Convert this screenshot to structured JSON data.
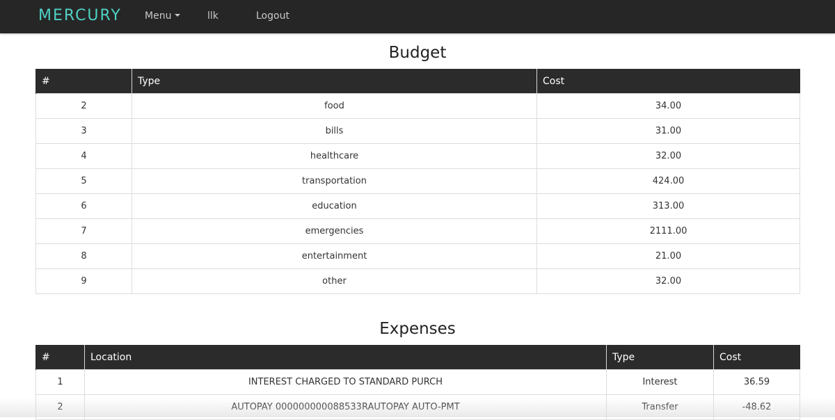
{
  "app": {
    "brand": "MERCURY",
    "nav": {
      "menu_label": "Menu",
      "user_label": "llk",
      "logout_label": "Logout"
    }
  },
  "budget": {
    "title": "Budget",
    "columns": [
      "#",
      "Type",
      "Cost"
    ],
    "rows": [
      {
        "id": "2",
        "type": "food",
        "cost": "34.00"
      },
      {
        "id": "3",
        "type": "bills",
        "cost": "31.00"
      },
      {
        "id": "4",
        "type": "healthcare",
        "cost": "32.00"
      },
      {
        "id": "5",
        "type": "transportation",
        "cost": "424.00"
      },
      {
        "id": "6",
        "type": "education",
        "cost": "313.00"
      },
      {
        "id": "7",
        "type": "emergencies",
        "cost": "2111.00"
      },
      {
        "id": "8",
        "type": "entertainment",
        "cost": "21.00"
      },
      {
        "id": "9",
        "type": "other",
        "cost": "32.00"
      }
    ]
  },
  "expenses": {
    "title": "Expenses",
    "columns": [
      "#",
      "Location",
      "Type",
      "Cost"
    ],
    "rows": [
      {
        "id": "1",
        "location": "INTEREST CHARGED TO STANDARD PURCH",
        "type": "Interest",
        "cost": "36.59"
      },
      {
        "id": "2",
        "location": "AUTOPAY 000000000088533RAUTOPAY AUTO-PMT",
        "type": "Transfer",
        "cost": "-48.62"
      }
    ]
  },
  "colors": {
    "navbar_bg": "#262626",
    "brand_accent": "#4fd1c5",
    "table_header_bg": "#2b2b2b"
  }
}
